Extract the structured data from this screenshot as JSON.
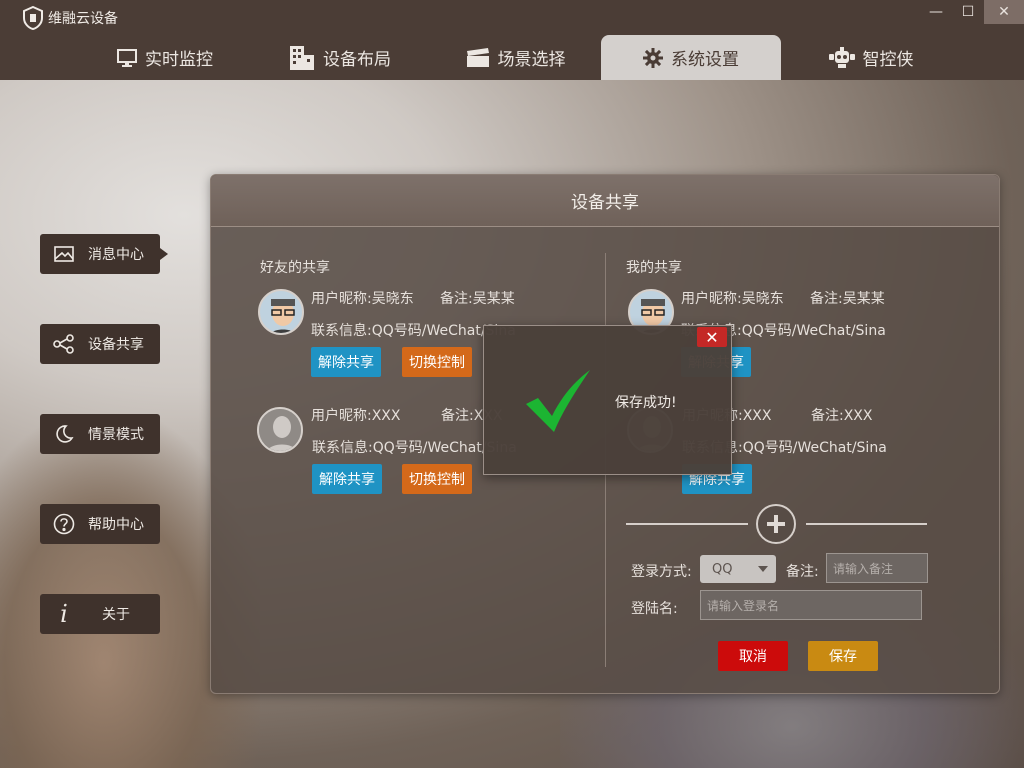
{
  "app": {
    "title": "维融云设备"
  },
  "window": {
    "minimize": "—",
    "maximize": "☐",
    "close": "✕"
  },
  "nav": {
    "tabs": [
      {
        "label": "实时监控",
        "icon": "monitor-icon"
      },
      {
        "label": "设备布局",
        "icon": "building-icon"
      },
      {
        "label": "场景选择",
        "icon": "clapperboard-icon"
      },
      {
        "label": "系统设置",
        "icon": "gear-icon",
        "active": true
      },
      {
        "label": "智控侠",
        "icon": "robot-icon"
      }
    ]
  },
  "sidebar": {
    "items": [
      {
        "label": "消息中心",
        "icon": "mail-icon",
        "active": true
      },
      {
        "label": "设备共享",
        "icon": "share-icon"
      },
      {
        "label": "情景模式",
        "icon": "moon-icon"
      },
      {
        "label": "帮助中心",
        "icon": "help-icon"
      },
      {
        "label": "关于",
        "icon": "info-icon"
      }
    ]
  },
  "panel": {
    "title": "设备共享",
    "friends": {
      "title": "好友的共享",
      "users": [
        {
          "nickname": "用户昵称:吴晓东",
          "note": "备注:吴某某",
          "contact": "联系信息:QQ号码/WeChat/Sina",
          "unshare": "解除共享",
          "switch": "切换控制"
        },
        {
          "nickname": "用户昵称:XXX",
          "note": "备注:XXX",
          "contact": "联系信息:QQ号码/WeChat/Sina",
          "unshare": "解除共享",
          "switch": "切换控制"
        }
      ]
    },
    "mine": {
      "title": "我的共享",
      "users": [
        {
          "nickname": "用户昵称:吴晓东",
          "note": "备注:吴某某",
          "contact": "联系信息:QQ号码/WeChat/Sina",
          "unshare": "解除共享"
        },
        {
          "nickname": "用户昵称:XXX",
          "note": "备注:XXX",
          "contact": "联系信息:QQ号码/WeChat/Sina",
          "unshare": "解除共享"
        }
      ]
    },
    "form": {
      "login_method_label": "登录方式:",
      "login_method_value": "QQ",
      "note_label": "备注:",
      "note_placeholder": "请输入备注",
      "login_name_label": "登陆名:",
      "login_name_placeholder": "请输入登录名",
      "cancel": "取消",
      "save": "保存"
    }
  },
  "dialog": {
    "message": "保存成功!",
    "close": "✕"
  },
  "colors": {
    "accent_blue": "#1f93c4",
    "accent_orange": "#d4691a",
    "cancel_red": "#cc0b0b",
    "save_gold": "#c98a12",
    "success_green": "#1cb532"
  }
}
